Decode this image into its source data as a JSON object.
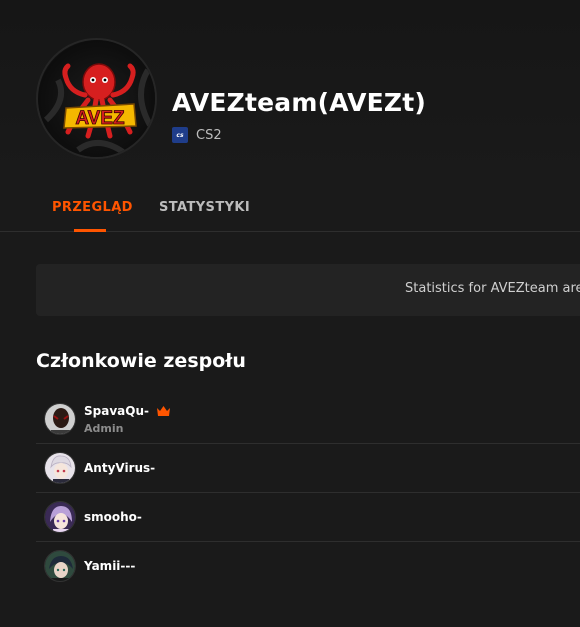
{
  "team": {
    "name": "AVEZteam(AVEZt)",
    "logo_text": "AVEZ",
    "game_icon_text": "cs",
    "game": "CS2"
  },
  "tabs": [
    {
      "label": "PRZEGLĄD",
      "active": true
    },
    {
      "label": "STATYSTYKI",
      "active": false
    }
  ],
  "stats_notice": "Statistics for AVEZteam are",
  "members_section": {
    "title": "Członkowie zespołu",
    "members": [
      {
        "name": "SpavaQu-",
        "role": "Admin",
        "crown": true
      },
      {
        "name": "AntyVirus-",
        "role": "",
        "crown": false
      },
      {
        "name": "smooho-",
        "role": "",
        "crown": false
      },
      {
        "name": "Yamii---",
        "role": "",
        "crown": false
      }
    ]
  },
  "colors": {
    "accent": "#ff5500",
    "background": "#1a1a1a",
    "panel": "#232323",
    "logo_yellow": "#f5b800",
    "logo_red": "#d61f1f"
  }
}
